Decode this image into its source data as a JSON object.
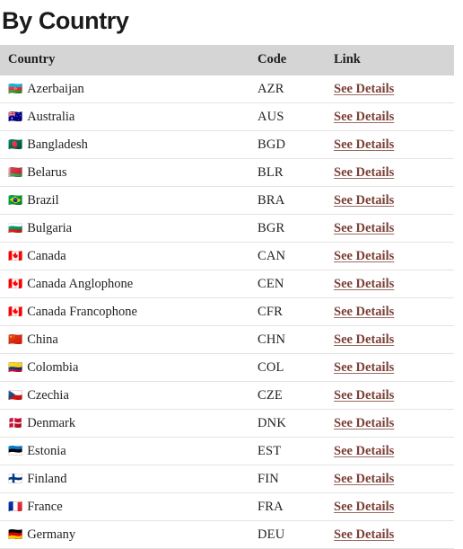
{
  "page": {
    "title": "By Country"
  },
  "table": {
    "columns": [
      {
        "key": "country",
        "label": "Country"
      },
      {
        "key": "code",
        "label": "Code"
      },
      {
        "key": "link",
        "label": "Link"
      }
    ],
    "header_background": "#d5d5d5",
    "link_color": "#7b3f36",
    "row_border_color": "#e3e3e3",
    "link_label": "See Details",
    "rows": [
      {
        "flag": "🇦🇿",
        "flag_name": "flag-azerbaijan",
        "country": "Azerbaijan",
        "code": "AZR",
        "link": "See Details"
      },
      {
        "flag": "🇦🇺",
        "flag_name": "flag-australia",
        "country": "Australia",
        "code": "AUS",
        "link": "See Details"
      },
      {
        "flag": "🇧🇩",
        "flag_name": "flag-bangladesh",
        "country": "Bangladesh",
        "code": "BGD",
        "link": "See Details"
      },
      {
        "flag": "🇧🇾",
        "flag_name": "flag-belarus",
        "country": "Belarus",
        "code": "BLR",
        "link": "See Details"
      },
      {
        "flag": "🇧🇷",
        "flag_name": "flag-brazil",
        "country": "Brazil",
        "code": "BRA",
        "link": "See Details"
      },
      {
        "flag": "🇧🇬",
        "flag_name": "flag-bulgaria",
        "country": "Bulgaria",
        "code": "BGR",
        "link": "See Details"
      },
      {
        "flag": "🇨🇦",
        "flag_name": "flag-canada",
        "country": "Canada",
        "code": "CAN",
        "link": "See Details"
      },
      {
        "flag": "🇨🇦",
        "flag_name": "flag-canada",
        "country": "Canada Anglophone",
        "code": "CEN",
        "link": "See Details"
      },
      {
        "flag": "🇨🇦",
        "flag_name": "flag-canada",
        "country": "Canada Francophone",
        "code": "CFR",
        "link": "See Details"
      },
      {
        "flag": "🇨🇳",
        "flag_name": "flag-china",
        "country": "China",
        "code": "CHN",
        "link": "See Details"
      },
      {
        "flag": "🇨🇴",
        "flag_name": "flag-colombia",
        "country": "Colombia",
        "code": "COL",
        "link": "See Details"
      },
      {
        "flag": "🇨🇿",
        "flag_name": "flag-czechia",
        "country": "Czechia",
        "code": "CZE",
        "link": "See Details"
      },
      {
        "flag": "🇩🇰",
        "flag_name": "flag-denmark",
        "country": "Denmark",
        "code": "DNK",
        "link": "See Details"
      },
      {
        "flag": "🇪🇪",
        "flag_name": "flag-estonia",
        "country": "Estonia",
        "code": "EST",
        "link": "See Details"
      },
      {
        "flag": "🇫🇮",
        "flag_name": "flag-finland",
        "country": "Finland",
        "code": "FIN",
        "link": "See Details"
      },
      {
        "flag": "🇫🇷",
        "flag_name": "flag-france",
        "country": "France",
        "code": "FRA",
        "link": "See Details"
      },
      {
        "flag": "🇩🇪",
        "flag_name": "flag-germany",
        "country": "Germany",
        "code": "DEU",
        "link": "See Details"
      }
    ]
  }
}
